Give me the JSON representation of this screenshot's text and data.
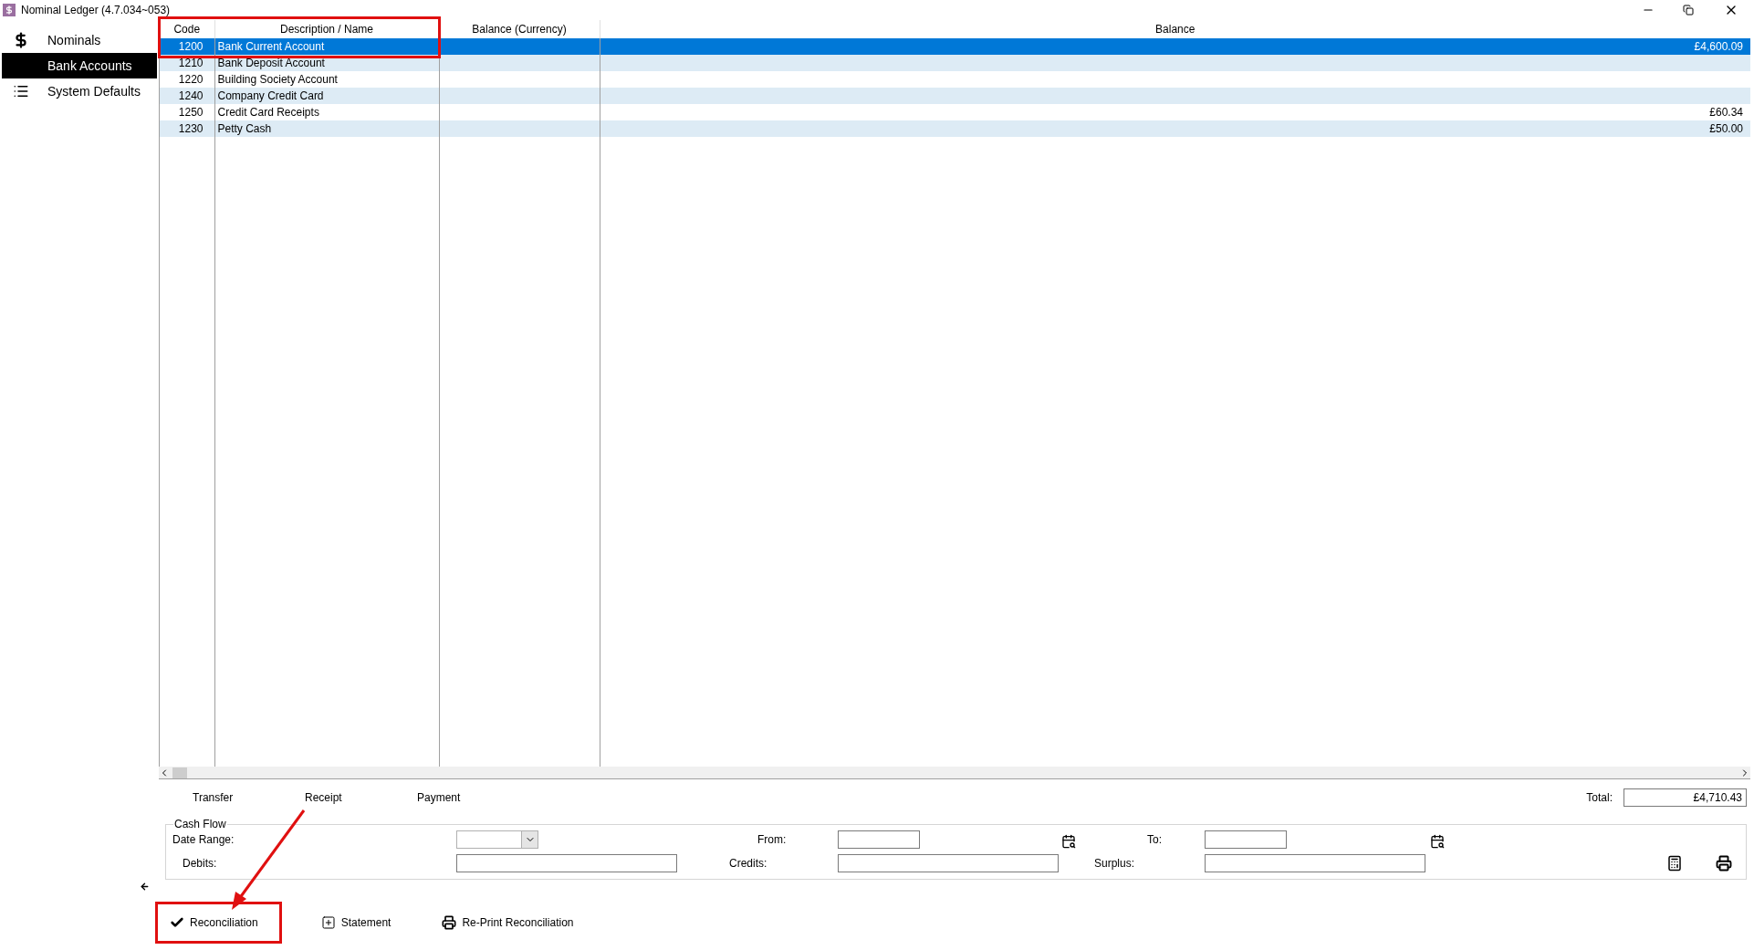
{
  "window": {
    "title": "Nominal Ledger (4.7.034~053)"
  },
  "sidebar": {
    "items": [
      {
        "label": "Nominals",
        "kind": "dollar",
        "selected": false
      },
      {
        "label": "Bank Accounts",
        "kind": "none",
        "selected": true
      },
      {
        "label": "System Defaults",
        "kind": "list",
        "selected": false
      }
    ]
  },
  "table": {
    "columns": [
      "Code",
      "Description / Name",
      "Balance (Currency)",
      "Balance"
    ],
    "rows": [
      {
        "code": "1200",
        "name": "Bank Current Account",
        "balance": "£4,600.09",
        "selected": true
      },
      {
        "code": "1210",
        "name": "Bank Deposit Account",
        "selected": false
      },
      {
        "code": "1220",
        "name": "Building Society Account",
        "selected": false
      },
      {
        "code": "1240",
        "name": "Company Credit Card",
        "selected": false
      },
      {
        "code": "1250",
        "name": "Credit Card Receipts",
        "balance": "£60.34",
        "selected": false
      },
      {
        "code": "1230",
        "name": "Petty Cash",
        "balance": "£50.00",
        "selected": false
      }
    ]
  },
  "actions": [
    "Transfer",
    "Receipt",
    "Payment"
  ],
  "total": {
    "label": "Total:",
    "value": "£4,710.43"
  },
  "cash_flow": {
    "title": "Cash Flow",
    "date_range_label": "Date Range:",
    "from_label": "From:",
    "to_label": "To:",
    "debits_label": "Debits:",
    "credits_label": "Credits:",
    "surplus_label": "Surplus:"
  },
  "buttons": [
    {
      "label": "Reconciliation",
      "kind": "check"
    },
    {
      "label": "Statement",
      "kind": "plus"
    },
    {
      "label": "Re-Print Reconciliation",
      "kind": "printer"
    }
  ]
}
